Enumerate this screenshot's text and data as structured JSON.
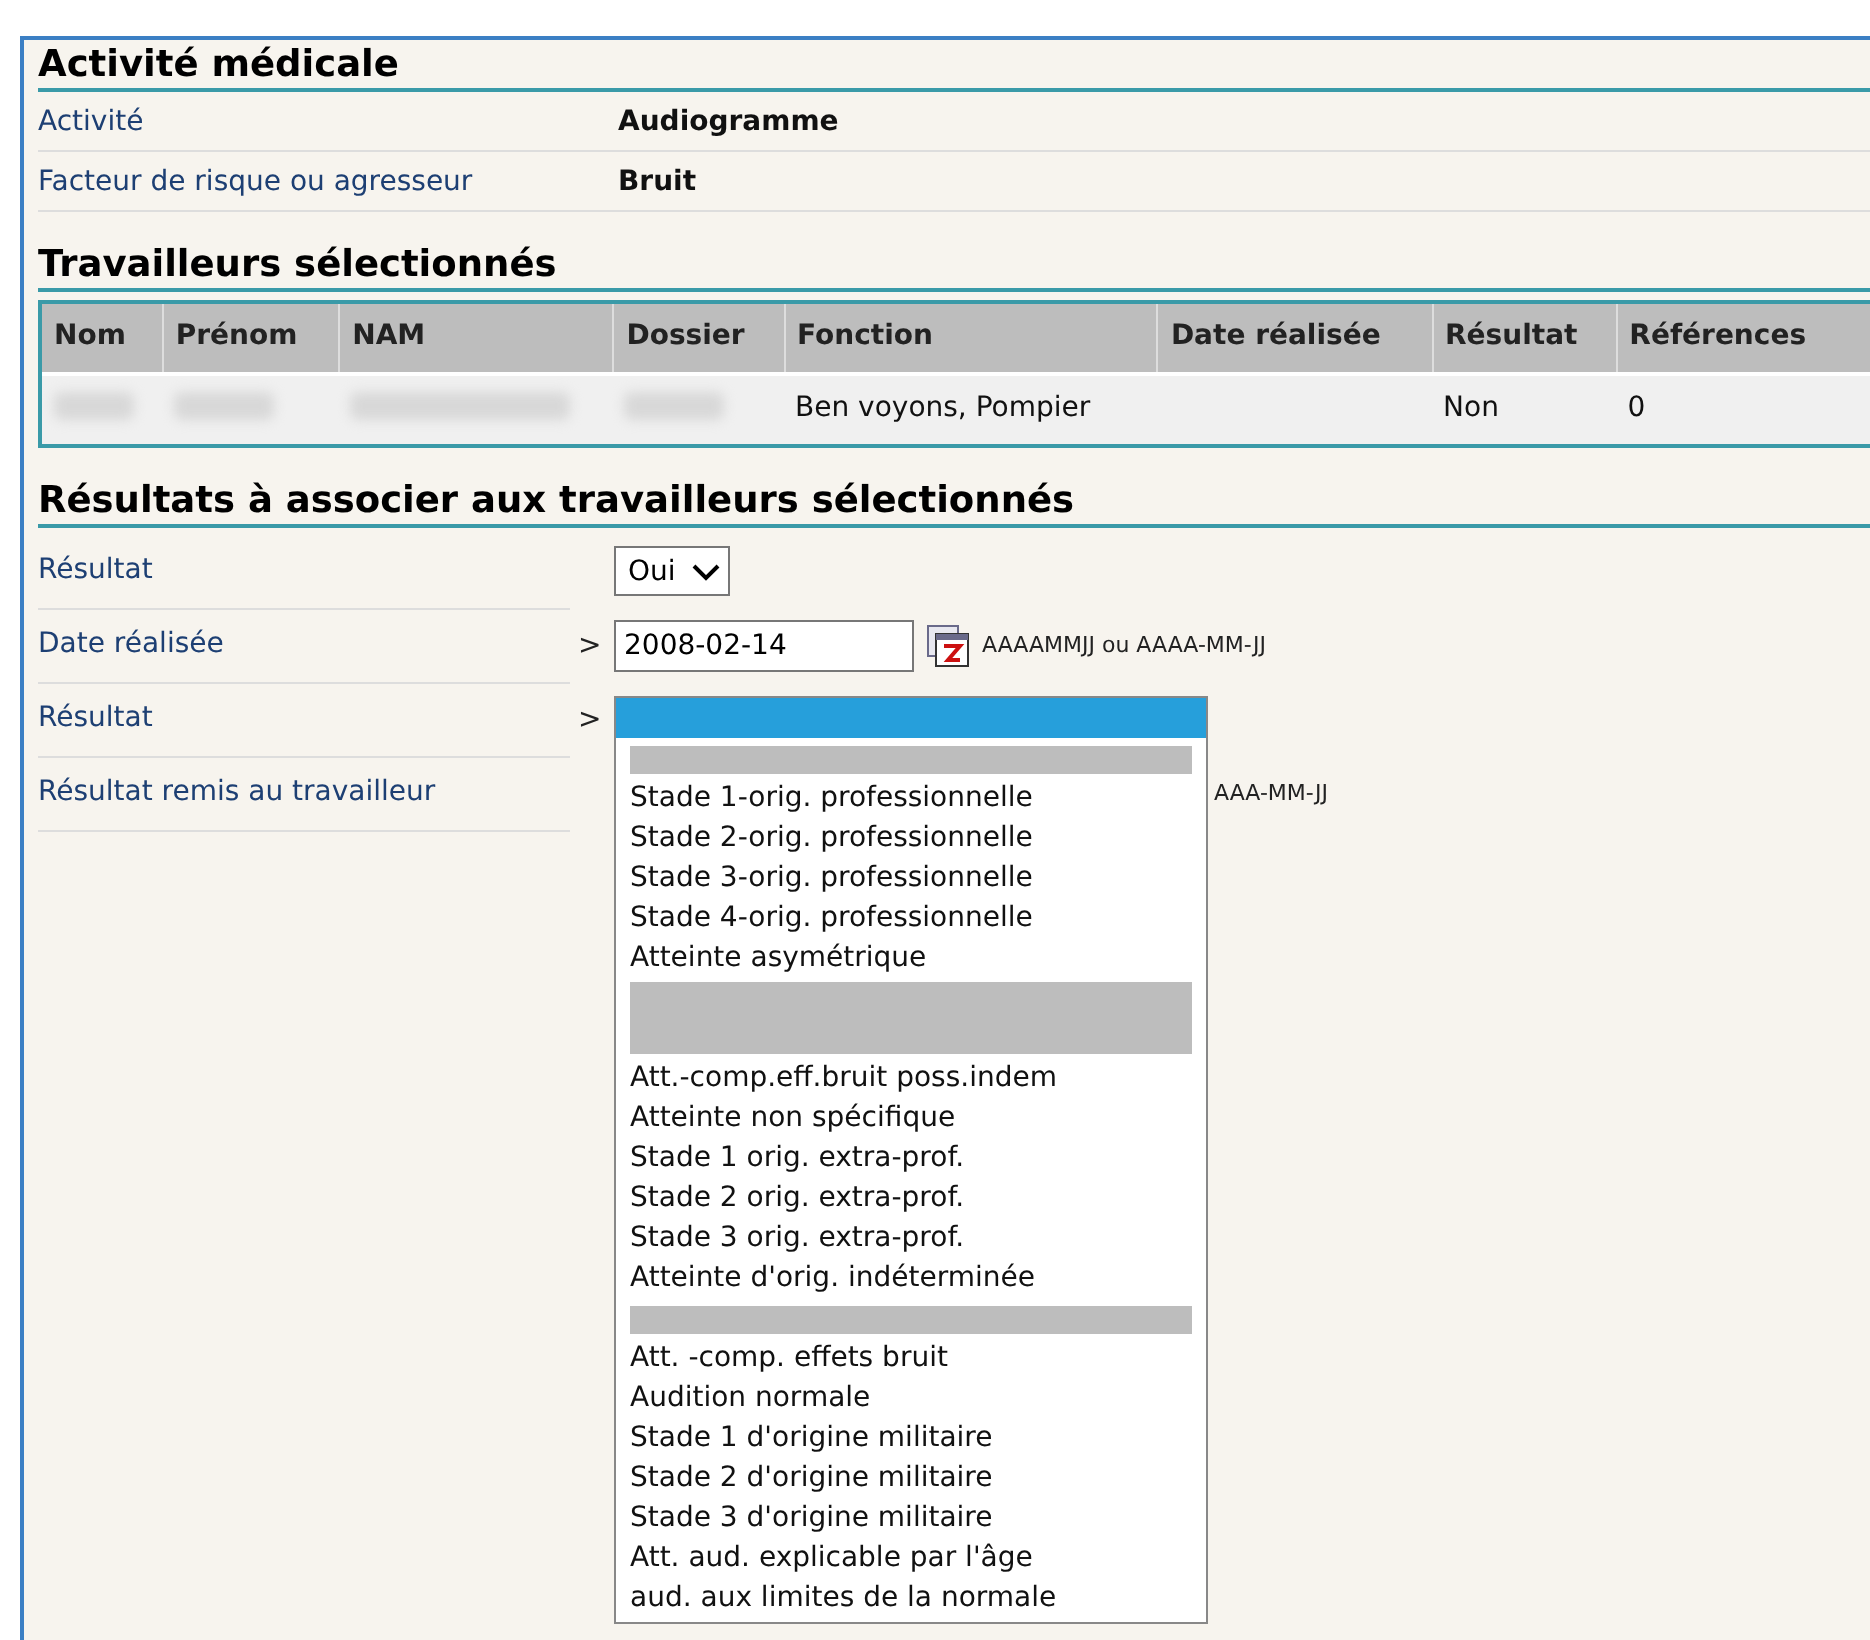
{
  "activity_section": {
    "title": "Activité médicale",
    "rows": [
      {
        "label": "Activité",
        "value": "Audiogramme"
      },
      {
        "label": "Facteur de risque ou agresseur",
        "value": "Bruit"
      }
    ]
  },
  "workers_section": {
    "title": "Travailleurs sélectionnés",
    "columns": [
      "Nom",
      "Prénom",
      "NAM",
      "Dossier",
      "Fonction",
      "Date réalisée",
      "Résultat",
      "Références"
    ],
    "rows": [
      {
        "cells": [
          {
            "kind": "blurred"
          },
          {
            "kind": "blurred"
          },
          {
            "kind": "blurred"
          },
          {
            "kind": "blurred"
          },
          {
            "kind": "text",
            "text": "Ben voyons, Pompier"
          },
          {
            "kind": "empty"
          },
          {
            "kind": "text",
            "text": "Non"
          },
          {
            "kind": "text",
            "text": "0"
          }
        ]
      }
    ]
  },
  "results_section": {
    "title": "Résultats à associer aux travailleurs sélectionnés",
    "rows": [
      {
        "label": "Résultat",
        "kind": "select",
        "value": "Oui",
        "marker": ""
      },
      {
        "label": "Date réalisée",
        "kind": "date",
        "value": "2008-02-14",
        "marker": ">",
        "hint": "AAAAMMJJ ou AAAA-MM-JJ"
      },
      {
        "label": "Résultat",
        "kind": "open_select",
        "marker": ">"
      },
      {
        "label": "Résultat remis au travailleur",
        "kind": "covered",
        "hint": "AAA-MM-JJ"
      }
    ]
  },
  "dropdown": {
    "options": [
      {
        "kind": "option",
        "selected": true
      },
      {
        "kind": "separator"
      },
      {
        "kind": "option",
        "text": "Stade 1-orig. professionnelle",
        "selected": false
      },
      {
        "kind": "option",
        "text": "Stade 2-orig. professionnelle",
        "selected": false
      },
      {
        "kind": "option",
        "text": "Stade 3-orig. professionnelle",
        "selected": false
      },
      {
        "kind": "option",
        "text": "Stade 4-orig. professionnelle",
        "selected": false
      },
      {
        "kind": "option",
        "text": "Atteinte asymétrique",
        "selected": false
      },
      {
        "kind": "wide_separator"
      },
      {
        "kind": "option",
        "text": "Att.-comp.eff.bruit poss.indem",
        "selected": false
      },
      {
        "kind": "option",
        "text": "Atteinte non spécifique",
        "selected": false
      },
      {
        "kind": "option",
        "text": "Stade 1 orig. extra-prof.",
        "selected": false
      },
      {
        "kind": "option",
        "text": "Stade 2 orig. extra-prof.",
        "selected": false
      },
      {
        "kind": "option",
        "text": "Stade 3 orig. extra-prof.",
        "selected": false
      },
      {
        "kind": "option",
        "text": "Atteinte d'orig. indéterminée",
        "selected": false
      },
      {
        "kind": "separator"
      },
      {
        "kind": "option",
        "text": "Att. -comp. effets bruit",
        "selected": false
      },
      {
        "kind": "option",
        "text": "Audition normale",
        "selected": false
      },
      {
        "kind": "option",
        "text": "Stade 1 d'origine militaire",
        "selected": false
      },
      {
        "kind": "option",
        "text": "Stade 2 d'origine militaire",
        "selected": false
      },
      {
        "kind": "option",
        "text": "Stade 3 d'origine militaire",
        "selected": false
      },
      {
        "kind": "option",
        "text": "Att. aud. explicable par l'âge",
        "selected": false
      },
      {
        "kind": "option",
        "text": "aud. aux limites de la normale",
        "selected": false
      }
    ]
  }
}
